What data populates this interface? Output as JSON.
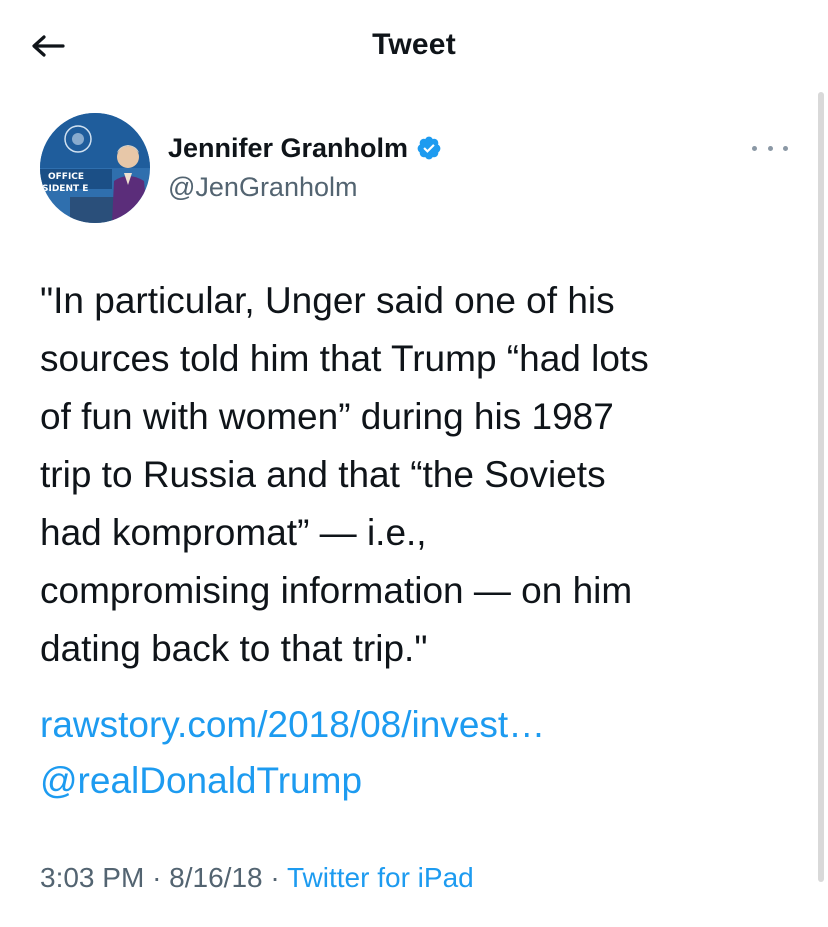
{
  "header": {
    "title": "Tweet",
    "back_icon": "arrow-left-icon"
  },
  "author": {
    "display_name": "Jennifer Granholm",
    "handle": "@JenGranholm",
    "verified_icon": "verified-badge-icon",
    "avatar_text": [
      "OFFICE",
      "SIDENT E"
    ]
  },
  "tweet": {
    "lines": [
      "\"In particular, Unger said one of his",
      "sources told him that Trump “had lots",
      "of fun with women” during his 1987",
      "trip to Russia and that “the Soviets",
      "had kompromat” — i.e.,",
      "compromising information — on him",
      "dating back to that trip.\""
    ],
    "link": "rawstory.com/2018/08/invest…",
    "mention": "@realDonaldTrump"
  },
  "meta": {
    "time": "3:03 PM",
    "date": "8/16/18",
    "separator": "·",
    "source": "Twitter for iPad"
  },
  "colors": {
    "accent": "#1d9bf0",
    "text": "#0f1419",
    "secondary": "#536471"
  }
}
